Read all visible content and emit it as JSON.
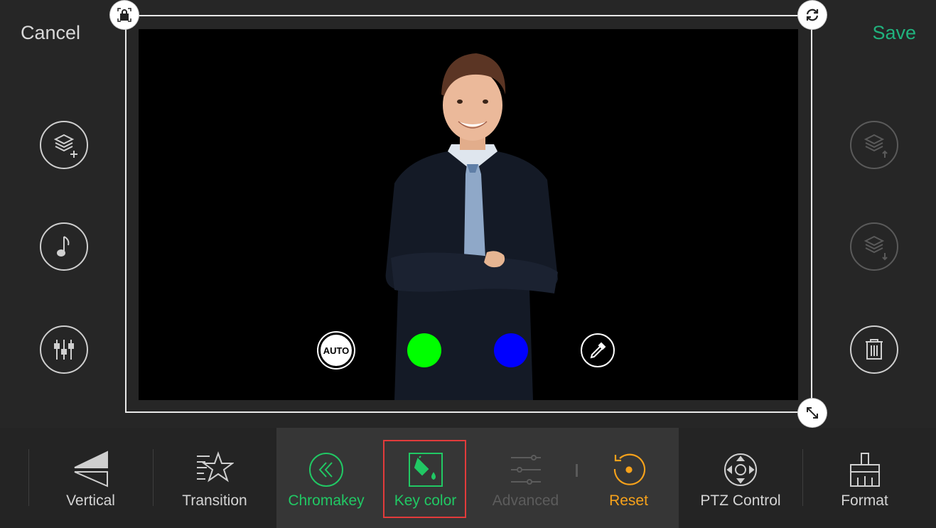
{
  "header": {
    "cancel_label": "Cancel",
    "save_label": "Save"
  },
  "left_icons": [
    "add-layer-icon",
    "music-icon",
    "mixer-icon"
  ],
  "right_icons": [
    "layer-up-icon",
    "layer-down-icon",
    "trash-icon"
  ],
  "frame_corners": [
    "lock-icon",
    "rotate-icon",
    "resize-icon"
  ],
  "key_colors": {
    "auto_label": "AUTO",
    "green": "#00ff00",
    "blue": "#0000ff",
    "picker_icon": "eyedropper-icon"
  },
  "toolbar": {
    "vertical": "Vertical",
    "transition": "Transition",
    "chromakey": "Chromakey",
    "key_color": "Key color",
    "advanced": "Advanced",
    "reset": "Reset",
    "ptz_control": "PTZ Control",
    "format": "Format"
  },
  "colors": {
    "accent_green": "#21c864",
    "save_green": "#20b37e",
    "reset_orange": "#f7a21b",
    "highlight_red": "#e23b3b"
  }
}
